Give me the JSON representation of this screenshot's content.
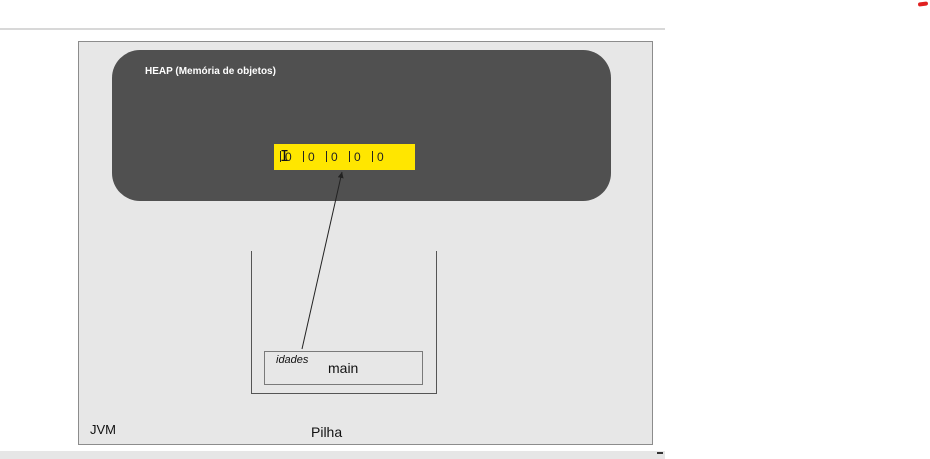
{
  "heap": {
    "title": "HEAP (Memória de objetos)"
  },
  "array": {
    "values": [
      "0",
      "0",
      "0",
      "0",
      "0"
    ],
    "color": "#ffe600"
  },
  "stack": {
    "frame_name": "main",
    "variable": "idades",
    "label": "Pilha"
  },
  "jvm": {
    "label": "JVM"
  },
  "colors": {
    "heap_bg": "#505050",
    "jvm_bg": "#e7e7e7",
    "annotation_mark": "#e02020"
  }
}
